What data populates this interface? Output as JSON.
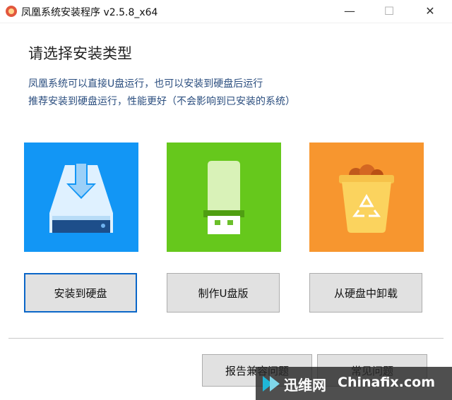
{
  "window": {
    "title": "凤凰系统安装程序 v2.5.8_x64",
    "minimize_glyph": "—",
    "maximize_glyph": "☐",
    "close_glyph": "✕"
  },
  "main": {
    "heading": "请选择安装类型",
    "description_line1": "凤凰系统可以直接U盘运行，也可以安装到硬盘后运行",
    "description_line2": "推荐安装到硬盘运行，性能更好（不会影响到已安装的系统）"
  },
  "options": [
    {
      "label": "安装到硬盘",
      "icon": "hard-disk-install-icon",
      "color": "#1296f5",
      "selected": true
    },
    {
      "label": "制作U盘版",
      "icon": "usb-drive-icon",
      "color": "#66c81c",
      "selected": false
    },
    {
      "label": "从硬盘中卸载",
      "icon": "recycle-bin-icon",
      "color": "#f7962f",
      "selected": false
    }
  ],
  "footer": {
    "report_label": "报告兼容问题",
    "faq_label": "常见问题"
  },
  "watermark": {
    "brand_cn": "迅维网",
    "brand_en": "Chinafix.com"
  }
}
